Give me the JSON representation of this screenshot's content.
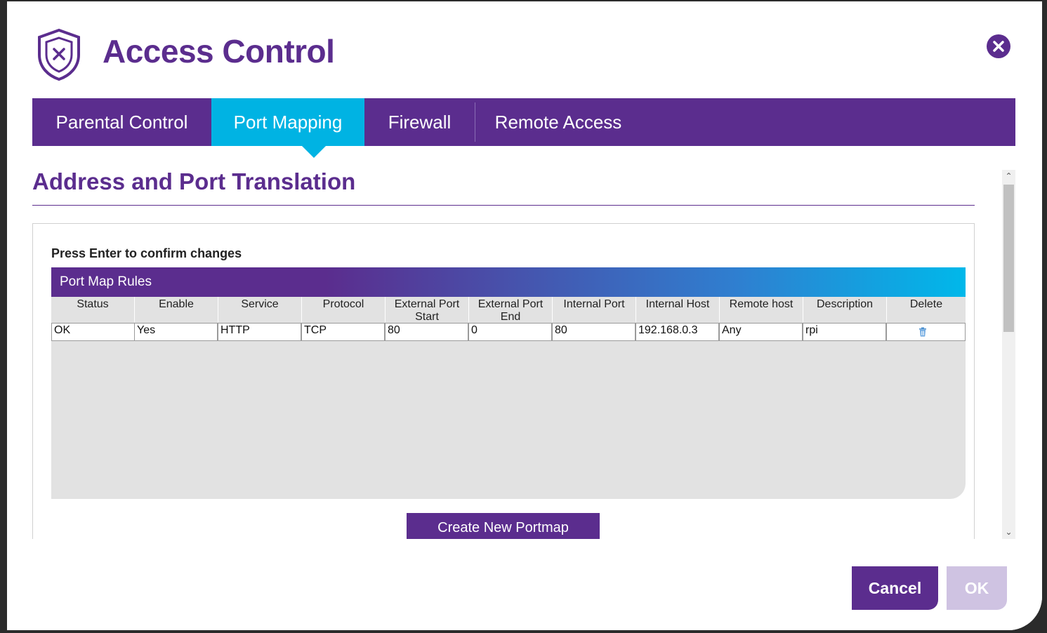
{
  "dialog": {
    "title": "Access Control"
  },
  "tabs": [
    {
      "label": "Parental Control"
    },
    {
      "label": "Port Mapping",
      "active": true
    },
    {
      "label": "Firewall"
    },
    {
      "label": "Remote Access"
    }
  ],
  "section": {
    "title": "Address and Port Translation"
  },
  "panel": {
    "hint": "Press Enter to confirm changes"
  },
  "table": {
    "title": "Port Map Rules",
    "columns": [
      "Status",
      "Enable",
      "Service",
      "Protocol",
      "External Port Start",
      "External Port End",
      "Internal Port",
      "Internal Host",
      "Remote host",
      "Description",
      "Delete"
    ],
    "rows": [
      {
        "status": "OK",
        "enable": "Yes",
        "service": "HTTP",
        "protocol": "TCP",
        "ext_start": "80",
        "ext_end": "0",
        "int_port": "80",
        "int_host": "192.168.0.3",
        "remote_host": "Any",
        "description": "rpi"
      }
    ]
  },
  "buttons": {
    "create": "Create New Portmap",
    "cancel": "Cancel",
    "ok": "OK"
  },
  "colors": {
    "brand": "#5b2d8e",
    "accent": "#00b3e3",
    "disabled": "#cfc3e2"
  },
  "icons": {
    "header": "shield-x-icon",
    "close": "close-icon",
    "delete": "trash-icon"
  }
}
